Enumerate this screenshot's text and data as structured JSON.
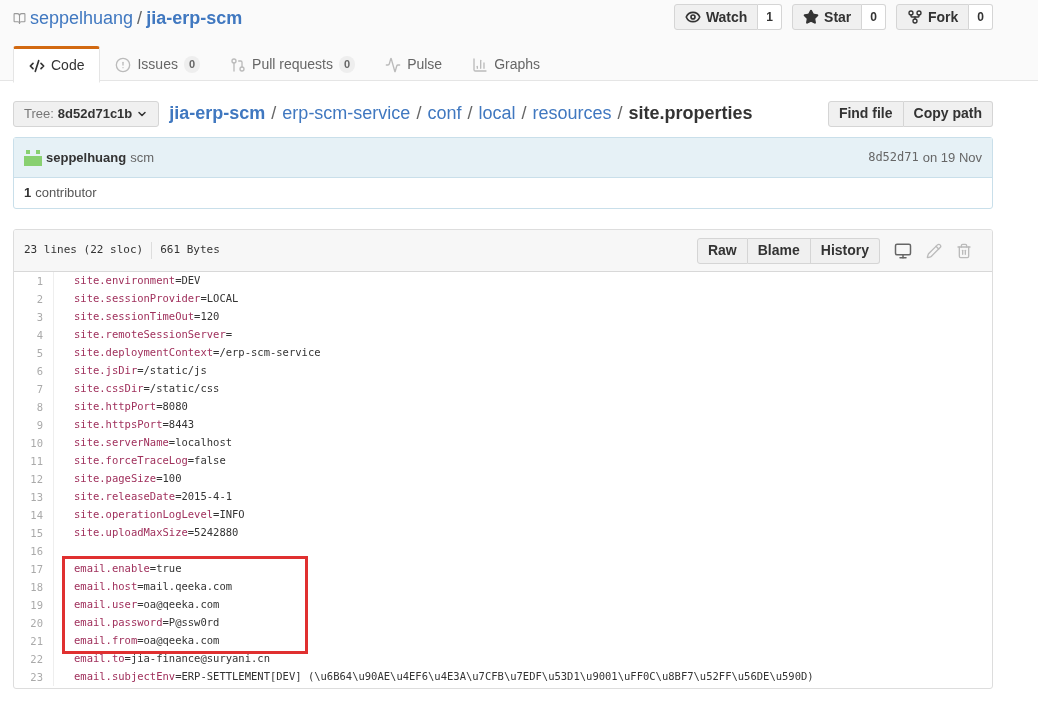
{
  "repo": {
    "owner": "seppelhuang",
    "separator": "/",
    "name": "jia-erp-scm"
  },
  "repo_actions": [
    {
      "label": "Watch",
      "count": "1",
      "kind": "watch"
    },
    {
      "label": "Star",
      "count": "0",
      "kind": "star"
    },
    {
      "label": "Fork",
      "count": "0",
      "kind": "fork"
    }
  ],
  "tabs": [
    {
      "label": "Code",
      "kind": "code",
      "selected": true
    },
    {
      "label": "Issues",
      "counter": "0",
      "kind": "issues",
      "selected": false
    },
    {
      "label": "Pull requests",
      "counter": "0",
      "kind": "pulls",
      "selected": false
    },
    {
      "label": "Pulse",
      "kind": "pulse",
      "selected": false
    },
    {
      "label": "Graphs",
      "kind": "graphs",
      "selected": false
    }
  ],
  "branch_selector": {
    "prefix": "Tree:",
    "value": "8d52d71c1b"
  },
  "breadcrumb": {
    "parts": [
      "jia-erp-scm",
      "erp-scm-service",
      "conf",
      "local",
      "resources"
    ],
    "separator": "/",
    "file": "site.properties"
  },
  "file_actions": [
    "Find file",
    "Copy path"
  ],
  "commit": {
    "author": "seppelhuang",
    "message": "scm",
    "sha": "8d52d71",
    "date": "on 19 Nov"
  },
  "contributors": {
    "count": "1",
    "label": "contributor"
  },
  "file_info": {
    "lines": "23 lines (22 sloc)",
    "size": "661 Bytes"
  },
  "file_buttons": [
    "Raw",
    "Blame",
    "History"
  ],
  "code_lines": [
    {
      "number": "1",
      "key": "site.environment",
      "value": "=DEV",
      "highlighted": false
    },
    {
      "number": "2",
      "key": "site.sessionProvider",
      "value": "=LOCAL",
      "highlighted": false
    },
    {
      "number": "3",
      "key": "site.sessionTimeOut",
      "value": "=120",
      "highlighted": false
    },
    {
      "number": "4",
      "key": "site.remoteSessionServer",
      "value": "=",
      "highlighted": false
    },
    {
      "number": "5",
      "key": "site.deploymentContext",
      "value": "=/erp-scm-service",
      "highlighted": false
    },
    {
      "number": "6",
      "key": "site.jsDir",
      "value": "=/static/js",
      "highlighted": false
    },
    {
      "number": "7",
      "key": "site.cssDir",
      "value": "=/static/css",
      "highlighted": false
    },
    {
      "number": "8",
      "key": "site.httpPort",
      "value": "=8080",
      "highlighted": false
    },
    {
      "number": "9",
      "key": "site.httpsPort",
      "value": "=8443",
      "highlighted": false
    },
    {
      "number": "10",
      "key": "site.serverName",
      "value": "=localhost",
      "highlighted": false
    },
    {
      "number": "11",
      "key": "site.forceTraceLog",
      "value": "=false",
      "highlighted": false
    },
    {
      "number": "12",
      "key": "site.pageSize",
      "value": "=100",
      "highlighted": false
    },
    {
      "number": "13",
      "key": "site.releaseDate",
      "value": "=2015-4-1",
      "highlighted": false
    },
    {
      "number": "14",
      "key": "site.operationLogLevel",
      "value": "=INFO",
      "highlighted": false
    },
    {
      "number": "15",
      "key": "site.uploadMaxSize",
      "value": "=5242880",
      "highlighted": false
    },
    {
      "number": "16",
      "highlighted": false
    },
    {
      "number": "17",
      "key": "email.enable",
      "value": "=true",
      "highlighted": true
    },
    {
      "number": "18",
      "key": "email.host",
      "value": "=mail.qeeka.com",
      "highlighted": true
    },
    {
      "number": "19",
      "key": "email.user",
      "value": "=oa@qeeka.com",
      "highlighted": true
    },
    {
      "number": "20",
      "key": "email.password",
      "value": "=P@ssw0rd",
      "highlighted": true
    },
    {
      "number": "21",
      "key": "email.from",
      "value": "=oa@qeeka.com",
      "highlighted": true
    },
    {
      "number": "22",
      "key": "email.to",
      "value": "=jia-finance@suryani.cn",
      "highlighted": false
    },
    {
      "number": "23",
      "key": "email.subjectEnv",
      "value": "=ERP-SETTLEMENT[DEV] (\\u6B64\\u90AE\\u4EF6\\u4E3A\\u7CFB\\u7EDF\\u53D1\\u9001\\uFF0C\\u8BF7\\u52FF\\u56DE\\u590D)",
      "highlighted": false
    }
  ]
}
